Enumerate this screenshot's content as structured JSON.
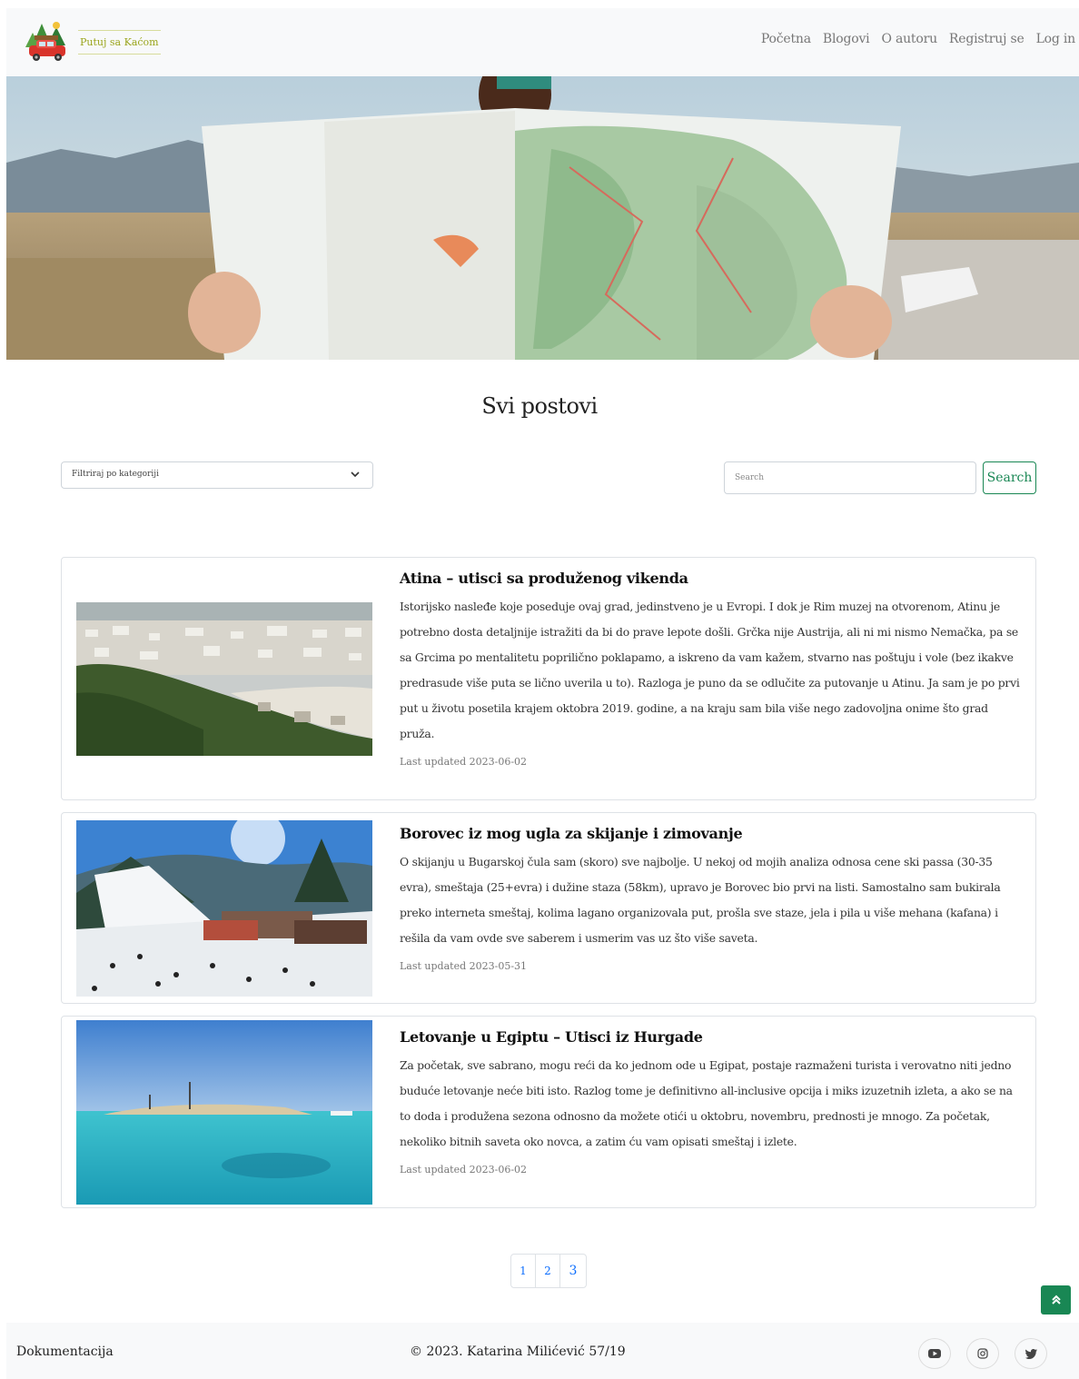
{
  "brand": {
    "name": "Putuj sa Kaćom",
    "logo_icon": "car-camping-logo-icon"
  },
  "nav": {
    "items": [
      {
        "label": "Početna"
      },
      {
        "label": "Blogovi"
      },
      {
        "label": "O autoru"
      },
      {
        "label": "Registruj se"
      },
      {
        "label": "Log in"
      }
    ]
  },
  "hero": {
    "image": "woman-reading-map"
  },
  "page": {
    "title": "Svi postovi"
  },
  "filter": {
    "selected": "Filtriraj po kategoriji",
    "icon": "chevron-down-icon"
  },
  "search": {
    "placeholder": "Search",
    "button_label": "Search"
  },
  "posts": [
    {
      "title": "Atina – utisci sa produženog vikenda",
      "excerpt": "Istorijsko nasleđe koje poseduje ovaj grad, jedinstveno je u Evropi. I dok je Rim muzej na otvorenom, Atinu je potrebno dosta detaljnije istražiti da bi do prave lepote došli. Grčka nije Austrija, ali ni mi nismo Nemačka, pa se sa Grcima po mentalitetu poprilično poklapamo, a iskreno da vam kažem, stvarno nas poštuju i vole (bez ikakve predrasude više puta se lično uverila u to). Razloga je puno da se odlučite za putovanje u Atinu. Ja sam je po prvi put u životu posetila krajem oktobra 2019. godine, a na kraju sam bila više nego zadovoljna onime što grad pruža.",
      "meta": "Last updated 2023-06-02",
      "image": "athens-city-view"
    },
    {
      "title": "Borovec iz mog ugla za skijanje i zimovanje",
      "excerpt": "O skijanju u Bugarskoj čula sam (skoro) sve najbolje. U nekoj od mojih analiza odnosa cene ski passa (30-35 evra), smeštaja (25+evra) i dužine staza (58km), upravo je Borovec bio prvi na listi. Samostalno sam bukirala preko interneta smeštaj, kolima lagano organizovala put, prošla sve staze, jela i pila u više mehana (kafana) i rešila da vam ovde sve saberem i usmerim vas uz što više saveta.",
      "meta": "Last updated 2023-05-31",
      "image": "borovets-ski-slope"
    },
    {
      "title": "Letovanje u Egiptu – Utisci iz Hurgade",
      "excerpt": "Za početak, sve sabrano, mogu reći da ko jednom ode u Egipat, postaje razmaženi turista i verovatno niti jedno buduće letovanje neće biti isto. Razlog tome je definitivno all-inclusive opcija i miks izuzetnih izleta, a ako se na to doda i produžena sezona odnosno da možete otići u oktobru, novembru, prednosti je mnogo. Za početak, nekoliko bitnih saveta oko novca, a zatim ću vam opisati smeštaj i izlete.",
      "meta": "Last updated 2023-06-02",
      "image": "hurghada-sea"
    }
  ],
  "pagination": {
    "pages": [
      "1",
      "2",
      "3"
    ]
  },
  "back_to_top": {
    "icon": "double-chevron-up-icon"
  },
  "footer": {
    "link": "Dokumentacija",
    "copyright": "© 2023. Katarina Milićević 57/19",
    "social": [
      "youtube-icon",
      "instagram-icon",
      "twitter-icon"
    ]
  },
  "colors": {
    "accent": "#198754",
    "link": "#0d6efd",
    "brand_text": "#9aa51c"
  }
}
